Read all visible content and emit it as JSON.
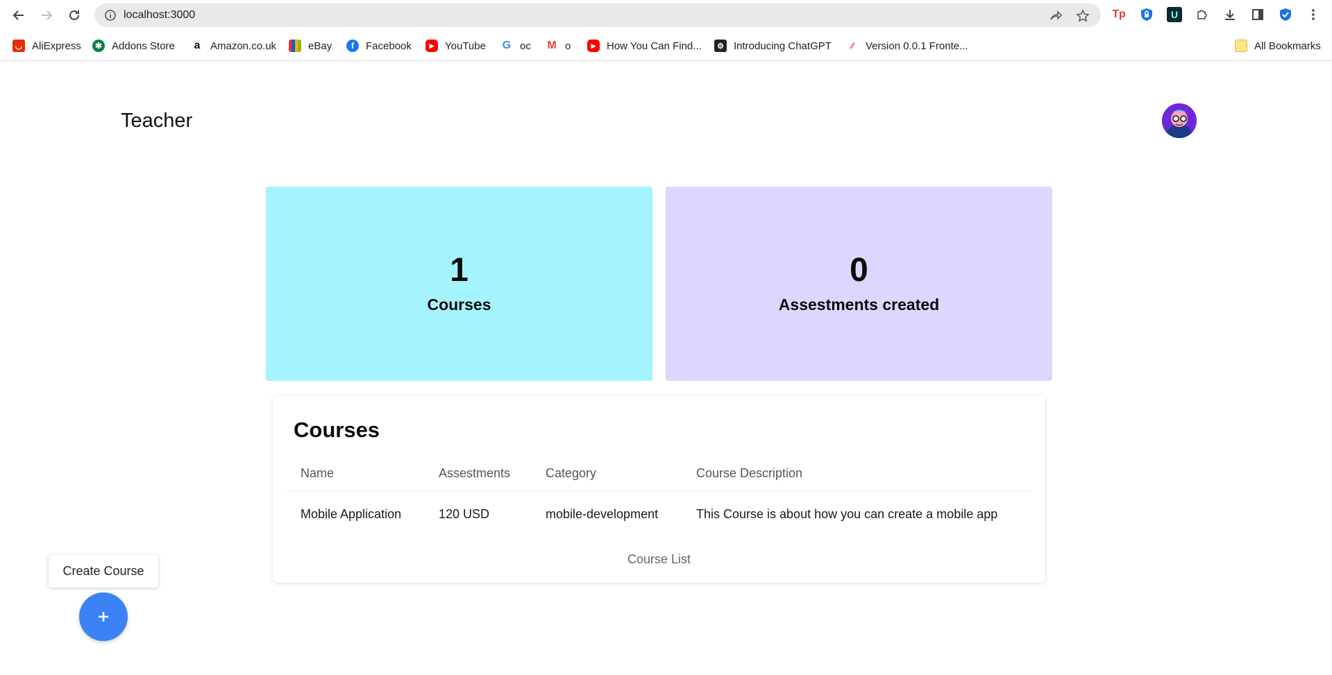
{
  "browser": {
    "url": "localhost:3000",
    "bookmarks": [
      {
        "label": "AliExpress",
        "icon": "aliexpress-icon",
        "color": "#e62e04"
      },
      {
        "label": "Addons Store",
        "icon": "addons-store-icon",
        "color": "#0a8043"
      },
      {
        "label": "Amazon.co.uk",
        "icon": "amazon-icon",
        "color": "#111111"
      },
      {
        "label": "eBay",
        "icon": "ebay-icon",
        "color": "#e53238"
      },
      {
        "label": "Facebook",
        "icon": "facebook-icon",
        "color": "#1877f2"
      },
      {
        "label": "YouTube",
        "icon": "youtube-icon",
        "color": "#ff0000"
      },
      {
        "label": "oc",
        "icon": "google-icon",
        "color": "#4285f4"
      },
      {
        "label": "o",
        "icon": "gmail-icon",
        "color": "#ea4335"
      },
      {
        "label": "How You Can Find...",
        "icon": "youtube-icon",
        "color": "#ff0000"
      },
      {
        "label": "Introducing ChatGPT",
        "icon": "chatgpt-icon",
        "color": "#222222"
      },
      {
        "label": "Version 0.0.1 Fronte...",
        "icon": "monday-icon",
        "color": "#ff3d57"
      }
    ],
    "all_bookmarks": "All Bookmarks"
  },
  "header": {
    "title": "Teacher"
  },
  "stats": {
    "courses": {
      "value": "1",
      "label": "Courses",
      "color": "#a5f3fc"
    },
    "assessments": {
      "value": "0",
      "label": "Assestments created",
      "color": "#ddd6fe"
    }
  },
  "courses_table": {
    "title": "Courses",
    "columns": [
      "Name",
      "Assestments",
      "Category",
      "Course Description"
    ],
    "rows": [
      [
        "Mobile Application",
        "120 USD",
        "mobile-development",
        "This Course is about how you can create a mobile app"
      ]
    ],
    "caption": "Course List"
  },
  "fab": {
    "tooltip": "Create Course",
    "icon": "plus-icon",
    "color": "#3b82f6"
  }
}
